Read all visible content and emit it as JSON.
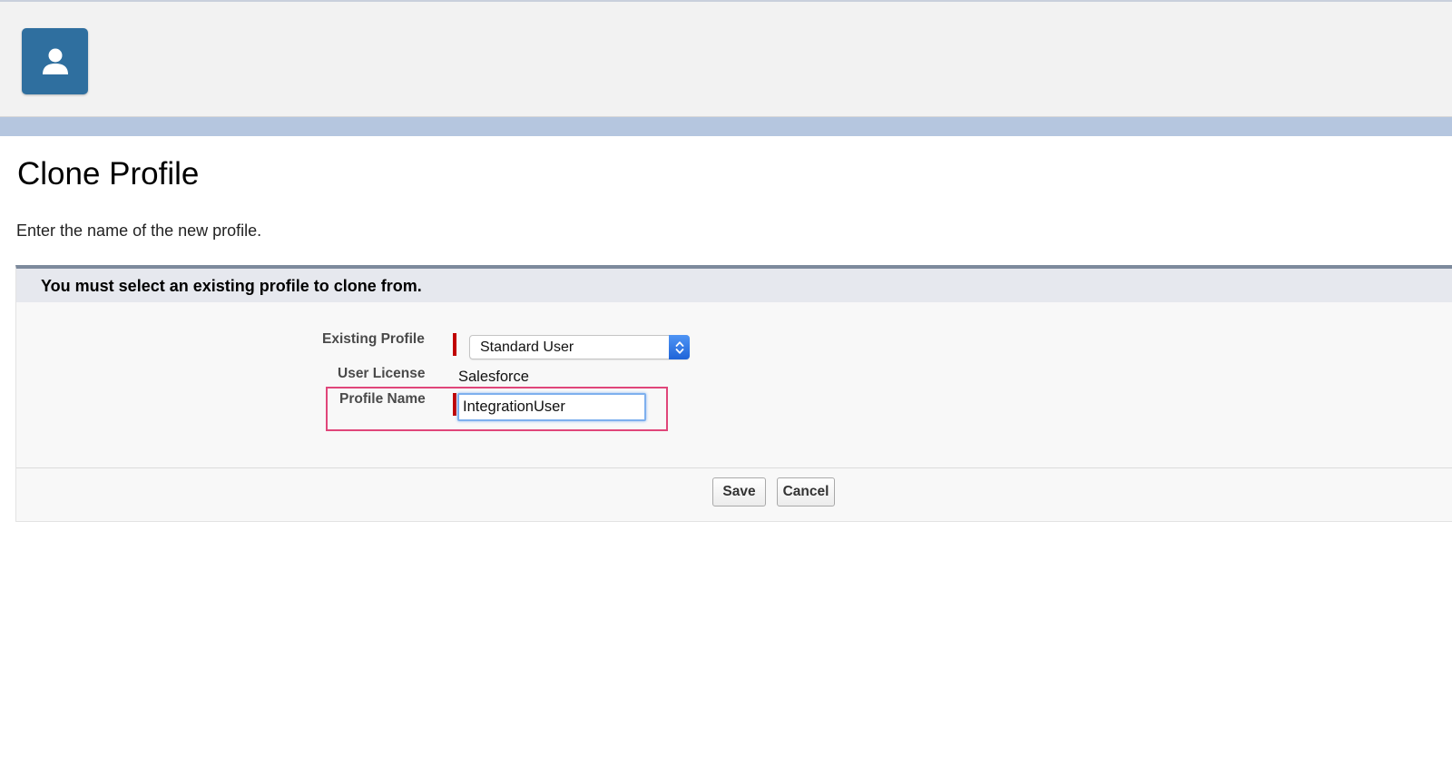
{
  "header": {
    "app_icon": "user-icon",
    "accent_color": "#2f6f9f"
  },
  "page": {
    "title": "Clone Profile",
    "description": "Enter the name of the new profile."
  },
  "panel": {
    "header": "You must select an existing profile to clone from.",
    "fields": {
      "existing_profile": {
        "label": "Existing Profile",
        "value": "Standard User",
        "required": true
      },
      "user_license": {
        "label": "User License",
        "value": "Salesforce"
      },
      "profile_name": {
        "label": "Profile Name",
        "value": "IntegrationUser",
        "required": true
      }
    },
    "buttons": {
      "save": "Save",
      "cancel": "Cancel"
    }
  },
  "colors": {
    "required_marker": "#c00000",
    "highlight": "#e0467a",
    "panel_top_border": "#7d8a9c"
  }
}
